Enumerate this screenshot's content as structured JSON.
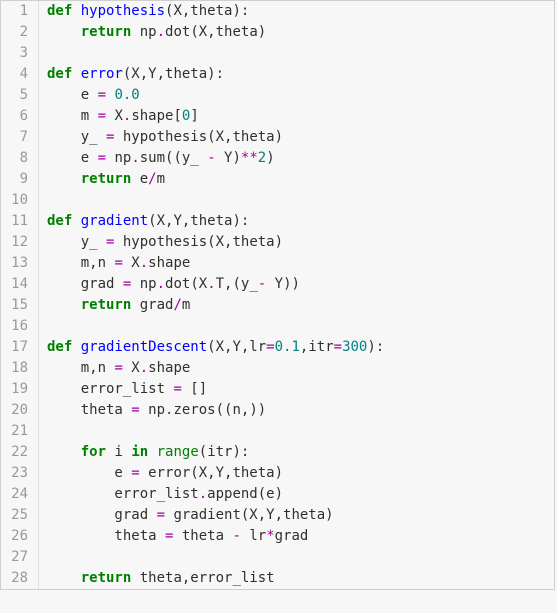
{
  "lines": [
    {
      "n": "1",
      "tokens": [
        {
          "t": "def ",
          "c": "kw"
        },
        {
          "t": "hypothesis",
          "c": "fn"
        },
        {
          "t": "(X,theta):",
          "c": ""
        }
      ]
    },
    {
      "n": "2",
      "tokens": [
        {
          "t": "    ",
          "c": ""
        },
        {
          "t": "return",
          "c": "kw"
        },
        {
          "t": " np",
          "c": ""
        },
        {
          "t": ".",
          "c": "op"
        },
        {
          "t": "dot(X,theta)",
          "c": ""
        }
      ]
    },
    {
      "n": "3",
      "tokens": []
    },
    {
      "n": "4",
      "tokens": [
        {
          "t": "def ",
          "c": "kw"
        },
        {
          "t": "error",
          "c": "fn"
        },
        {
          "t": "(X,Y,theta):",
          "c": ""
        }
      ]
    },
    {
      "n": "5",
      "tokens": [
        {
          "t": "    e ",
          "c": ""
        },
        {
          "t": "=",
          "c": "op"
        },
        {
          "t": " ",
          "c": ""
        },
        {
          "t": "0.0",
          "c": "num"
        }
      ]
    },
    {
      "n": "6",
      "tokens": [
        {
          "t": "    m ",
          "c": ""
        },
        {
          "t": "=",
          "c": "op"
        },
        {
          "t": " X",
          "c": ""
        },
        {
          "t": ".",
          "c": "op"
        },
        {
          "t": "shape[",
          "c": ""
        },
        {
          "t": "0",
          "c": "num"
        },
        {
          "t": "]",
          "c": ""
        }
      ]
    },
    {
      "n": "7",
      "tokens": [
        {
          "t": "    y_ ",
          "c": ""
        },
        {
          "t": "=",
          "c": "op"
        },
        {
          "t": " hypothesis(X,theta)",
          "c": ""
        }
      ]
    },
    {
      "n": "8",
      "tokens": [
        {
          "t": "    e ",
          "c": ""
        },
        {
          "t": "=",
          "c": "op"
        },
        {
          "t": " np",
          "c": ""
        },
        {
          "t": ".",
          "c": "op"
        },
        {
          "t": "sum((y_ ",
          "c": ""
        },
        {
          "t": "-",
          "c": "op"
        },
        {
          "t": " Y)",
          "c": ""
        },
        {
          "t": "**",
          "c": "op"
        },
        {
          "t": "2",
          "c": "num"
        },
        {
          "t": ")",
          "c": ""
        }
      ]
    },
    {
      "n": "9",
      "tokens": [
        {
          "t": "    ",
          "c": ""
        },
        {
          "t": "return",
          "c": "kw"
        },
        {
          "t": " e",
          "c": ""
        },
        {
          "t": "/",
          "c": "op"
        },
        {
          "t": "m",
          "c": ""
        }
      ]
    },
    {
      "n": "10",
      "tokens": []
    },
    {
      "n": "11",
      "tokens": [
        {
          "t": "def ",
          "c": "kw"
        },
        {
          "t": "gradient",
          "c": "fn"
        },
        {
          "t": "(X,Y,theta):",
          "c": ""
        }
      ]
    },
    {
      "n": "12",
      "tokens": [
        {
          "t": "    y_ ",
          "c": ""
        },
        {
          "t": "=",
          "c": "op"
        },
        {
          "t": " hypothesis(X,theta)",
          "c": ""
        }
      ]
    },
    {
      "n": "13",
      "tokens": [
        {
          "t": "    m,n ",
          "c": ""
        },
        {
          "t": "=",
          "c": "op"
        },
        {
          "t": " X",
          "c": ""
        },
        {
          "t": ".",
          "c": "op"
        },
        {
          "t": "shape",
          "c": ""
        }
      ]
    },
    {
      "n": "14",
      "tokens": [
        {
          "t": "    grad ",
          "c": ""
        },
        {
          "t": "=",
          "c": "op"
        },
        {
          "t": " np",
          "c": ""
        },
        {
          "t": ".",
          "c": "op"
        },
        {
          "t": "dot(X",
          "c": ""
        },
        {
          "t": ".",
          "c": "op"
        },
        {
          "t": "T,(y_",
          "c": ""
        },
        {
          "t": "-",
          "c": "op"
        },
        {
          "t": " Y))",
          "c": ""
        }
      ]
    },
    {
      "n": "15",
      "tokens": [
        {
          "t": "    ",
          "c": ""
        },
        {
          "t": "return",
          "c": "kw"
        },
        {
          "t": " grad",
          "c": ""
        },
        {
          "t": "/",
          "c": "op"
        },
        {
          "t": "m",
          "c": ""
        }
      ]
    },
    {
      "n": "16",
      "tokens": []
    },
    {
      "n": "17",
      "tokens": [
        {
          "t": "def ",
          "c": "kw"
        },
        {
          "t": "gradientDescent",
          "c": "fn"
        },
        {
          "t": "(X,Y,lr",
          "c": ""
        },
        {
          "t": "=",
          "c": "op"
        },
        {
          "t": "0.1",
          "c": "num"
        },
        {
          "t": ",itr",
          "c": ""
        },
        {
          "t": "=",
          "c": "op"
        },
        {
          "t": "300",
          "c": "num"
        },
        {
          "t": "):",
          "c": ""
        }
      ]
    },
    {
      "n": "18",
      "tokens": [
        {
          "t": "    m,n ",
          "c": ""
        },
        {
          "t": "=",
          "c": "op"
        },
        {
          "t": " X",
          "c": ""
        },
        {
          "t": ".",
          "c": "op"
        },
        {
          "t": "shape",
          "c": ""
        }
      ]
    },
    {
      "n": "19",
      "tokens": [
        {
          "t": "    error_list ",
          "c": ""
        },
        {
          "t": "=",
          "c": "op"
        },
        {
          "t": " []",
          "c": ""
        }
      ]
    },
    {
      "n": "20",
      "tokens": [
        {
          "t": "    theta ",
          "c": ""
        },
        {
          "t": "=",
          "c": "op"
        },
        {
          "t": " np",
          "c": ""
        },
        {
          "t": ".",
          "c": "op"
        },
        {
          "t": "zeros((n,))",
          "c": ""
        }
      ]
    },
    {
      "n": "21",
      "tokens": []
    },
    {
      "n": "22",
      "tokens": [
        {
          "t": "    ",
          "c": ""
        },
        {
          "t": "for",
          "c": "kw"
        },
        {
          "t": " i ",
          "c": ""
        },
        {
          "t": "in",
          "c": "kw"
        },
        {
          "t": " ",
          "c": ""
        },
        {
          "t": "range",
          "c": "builtin"
        },
        {
          "t": "(itr):",
          "c": ""
        }
      ]
    },
    {
      "n": "23",
      "tokens": [
        {
          "t": "        e ",
          "c": ""
        },
        {
          "t": "=",
          "c": "op"
        },
        {
          "t": " error(X,Y,theta)",
          "c": ""
        }
      ]
    },
    {
      "n": "24",
      "tokens": [
        {
          "t": "        error_list",
          "c": ""
        },
        {
          "t": ".",
          "c": "op"
        },
        {
          "t": "append(e)",
          "c": ""
        }
      ]
    },
    {
      "n": "25",
      "tokens": [
        {
          "t": "        grad ",
          "c": ""
        },
        {
          "t": "=",
          "c": "op"
        },
        {
          "t": " gradient(X,Y,theta)",
          "c": ""
        }
      ]
    },
    {
      "n": "26",
      "tokens": [
        {
          "t": "        theta ",
          "c": ""
        },
        {
          "t": "=",
          "c": "op"
        },
        {
          "t": " theta ",
          "c": ""
        },
        {
          "t": "-",
          "c": "op"
        },
        {
          "t": " lr",
          "c": ""
        },
        {
          "t": "*",
          "c": "op"
        },
        {
          "t": "grad",
          "c": ""
        }
      ]
    },
    {
      "n": "27",
      "tokens": []
    },
    {
      "n": "28",
      "tokens": [
        {
          "t": "    ",
          "c": ""
        },
        {
          "t": "return",
          "c": "kw"
        },
        {
          "t": " theta,error_list",
          "c": ""
        }
      ]
    }
  ]
}
